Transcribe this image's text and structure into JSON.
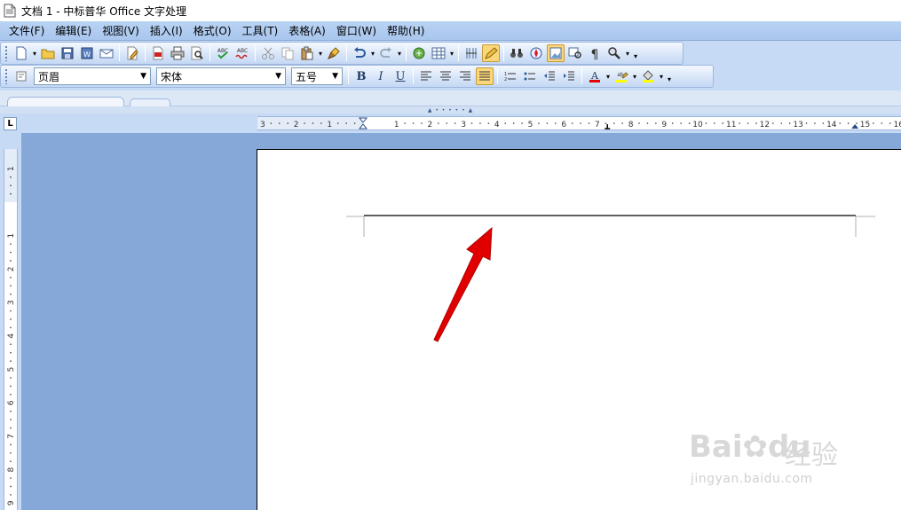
{
  "window": {
    "title": "文档 1 - 中标普华 Office 文字处理"
  },
  "menu": [
    "文件(F)",
    "编辑(E)",
    "视图(V)",
    "插入(I)",
    "格式(O)",
    "工具(T)",
    "表格(A)",
    "窗口(W)",
    "帮助(H)"
  ],
  "format_toolbar": {
    "style_value": "页眉",
    "font_value": "宋体",
    "size_value": "五号",
    "bold": "B",
    "italic": "I",
    "underline": "U"
  },
  "ruler": {
    "horizontal_labels": [
      "3",
      "2",
      "1",
      "1",
      "2",
      "3",
      "4",
      "5",
      "6",
      "7",
      "8",
      "9",
      "10",
      "11",
      "12",
      "13",
      "14",
      "15",
      "16"
    ],
    "vertical_labels": [
      "1",
      "1",
      "2",
      "3",
      "4",
      "5",
      "6",
      "7",
      "8",
      "9"
    ]
  },
  "watermark": {
    "brand": "Bai",
    "brand_tail": "du",
    "cn": "经验",
    "url": "jingyan.baidu.com"
  },
  "colors": {
    "workspace": "#85a8d9",
    "toolbar": "#c7daf5",
    "font_color": "#e00000",
    "highlight": "#ffff00",
    "arrow": "#e00000"
  }
}
